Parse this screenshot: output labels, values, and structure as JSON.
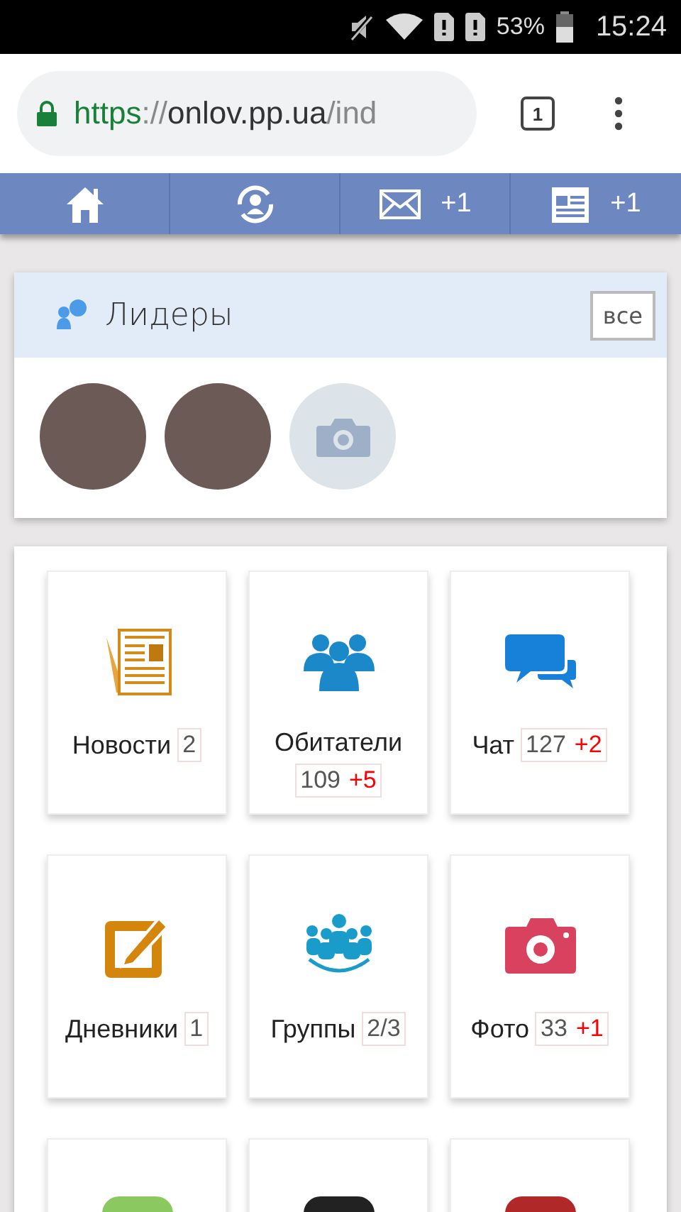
{
  "status_bar": {
    "battery": "53%",
    "time": "15:24"
  },
  "browser": {
    "url_scheme": "https",
    "url_sep": "://",
    "url_host": "onlov.pp.ua",
    "url_path": "/ind",
    "tab_count": "1"
  },
  "nav": [
    {
      "kind": "home"
    },
    {
      "kind": "profile"
    },
    {
      "kind": "mail",
      "badge": "+1"
    },
    {
      "kind": "news",
      "badge": "+1"
    }
  ],
  "leaders": {
    "title": "Лидеры",
    "all_button": "все",
    "avatars": [
      {
        "kind": "photo"
      },
      {
        "kind": "photo"
      },
      {
        "kind": "placeholder"
      }
    ]
  },
  "tiles": [
    {
      "kind": "news",
      "label": "Новости",
      "count": "2"
    },
    {
      "kind": "people",
      "label": "Обитатели",
      "count": "109",
      "new": "+5"
    },
    {
      "kind": "chat",
      "label": "Чат",
      "count": "127",
      "new": "+2"
    },
    {
      "kind": "diary",
      "label": "Дневники",
      "count": "1"
    },
    {
      "kind": "groups",
      "label": "Группы",
      "count": "2/3"
    },
    {
      "kind": "photo",
      "label": "Фото",
      "count": "33",
      "new": "+1"
    },
    {
      "kind": "partial",
      "color": "#8cc860"
    },
    {
      "kind": "partial",
      "color": "#222222"
    },
    {
      "kind": "partial",
      "color": "#b02828"
    }
  ]
}
